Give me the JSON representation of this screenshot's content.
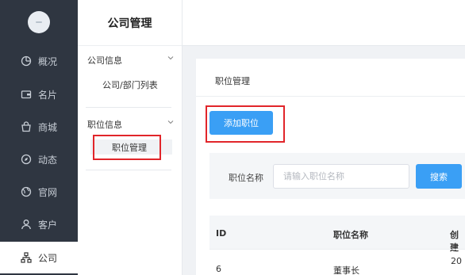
{
  "sidebar": {
    "items": [
      {
        "label": "概况",
        "icon": "pie-chart-icon"
      },
      {
        "label": "名片",
        "icon": "wallet-icon"
      },
      {
        "label": "商城",
        "icon": "shopping-bag-icon"
      },
      {
        "label": "动态",
        "icon": "compass-icon"
      },
      {
        "label": "官网",
        "icon": "globe-icon"
      },
      {
        "label": "客户",
        "icon": "user-icon"
      },
      {
        "label": "公司",
        "icon": "org-chart-icon"
      }
    ],
    "active_index": 6
  },
  "subnav": {
    "title": "公司管理",
    "groups": [
      {
        "label": "公司信息",
        "items": [
          "公司/部门列表"
        ]
      },
      {
        "label": "职位信息",
        "items": [
          "职位管理"
        ]
      }
    ]
  },
  "main": {
    "card_title": "职位管理",
    "add_button": "添加职位",
    "filter": {
      "label": "职位名称",
      "placeholder": "请输入职位名称",
      "search_button": "搜索"
    },
    "table": {
      "headers": [
        "ID",
        "职位名称",
        "创建"
      ],
      "rows": [
        {
          "id": "6",
          "name": "董事长",
          "created": "20"
        }
      ]
    }
  },
  "colors": {
    "sidebar_bg": "#2f3641",
    "primary": "#3a9ff5",
    "highlight": "#e1252a"
  }
}
